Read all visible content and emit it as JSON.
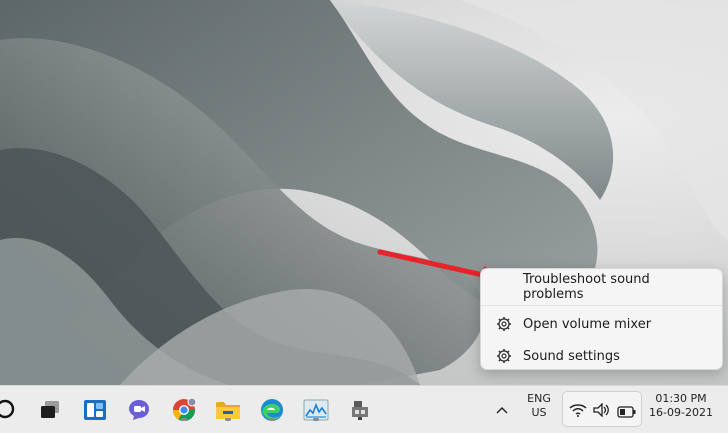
{
  "context_menu": {
    "items": [
      {
        "label": "Troubleshoot sound problems",
        "icon": "none"
      },
      {
        "label": "Open volume mixer",
        "icon": "gear-icon"
      },
      {
        "label": "Sound settings",
        "icon": "gear-icon"
      }
    ]
  },
  "taskbar": {
    "apps": [
      {
        "name": "search",
        "icon": "search-icon"
      },
      {
        "name": "task-view",
        "icon": "task-view-icon"
      },
      {
        "name": "widgets",
        "icon": "widgets-icon"
      },
      {
        "name": "chat",
        "icon": "teams-chat-icon"
      },
      {
        "name": "chrome",
        "icon": "chrome-icon"
      },
      {
        "name": "file-explorer",
        "icon": "folder-icon"
      },
      {
        "name": "edge",
        "icon": "edge-icon"
      },
      {
        "name": "task-manager",
        "icon": "task-manager-icon"
      },
      {
        "name": "network-app",
        "icon": "network-app-icon"
      }
    ],
    "tray": {
      "language_line1": "ENG",
      "language_line2": "US",
      "time": "01:30 PM",
      "date": "16-09-2021"
    }
  },
  "colors": {
    "arrow": "#e8242b",
    "taskbar_bg": "#ececec",
    "menu_bg": "#f5f5f5"
  }
}
